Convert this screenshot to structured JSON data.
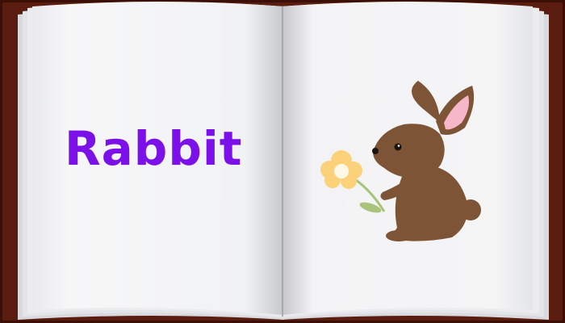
{
  "book": {
    "word": "Rabbit",
    "word_color": "#7b10e8",
    "cover_color": "#5a1c0f",
    "page_color": "#f3f4f6"
  },
  "illustration": {
    "subject": "rabbit-holding-flower",
    "rabbit_color": "#7d5536",
    "inner_ear_color": "#f6b7c8",
    "flower_color": "#fbd27a",
    "stem_color": "#a9c47a"
  }
}
